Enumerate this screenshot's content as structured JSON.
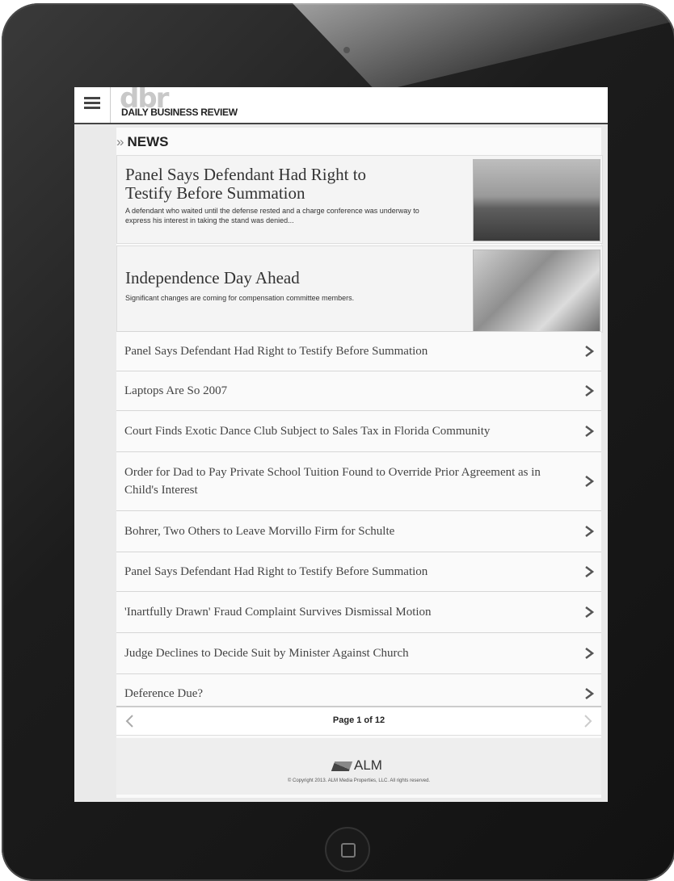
{
  "header": {
    "logo_mark": "dbr",
    "logo_text": "DAILY BUSINESS REVIEW"
  },
  "section": {
    "chevron": "»",
    "title": "NEWS"
  },
  "features": [
    {
      "headline": "Panel Says Defendant Had Right to Testify Before Summation",
      "summary": "A defendant who waited until the defense rested and a charge conference was underway to express his interest in taking the stand was denied..."
    },
    {
      "headline": "Independence Day Ahead",
      "summary": "Significant changes are coming for compensation committee members."
    }
  ],
  "articles": [
    "Panel Says Defendant Had Right to Testify Before Summation",
    "Laptops Are So 2007",
    "Court Finds Exotic Dance Club Subject to Sales Tax in Florida Community",
    "Order for Dad to Pay Private School Tuition Found to Override Prior Agreement as in Child's Interest",
    "Bohrer, Two Others to Leave Morvillo Firm for Schulte",
    "Panel Says Defendant Had Right to Testify Before Summation",
    "'Inartfully Drawn' Fraud Complaint Survives Dismissal Motion",
    "Judge Declines to Decide Suit by Minister Against Church",
    "Deference Due?"
  ],
  "pager": {
    "label": "Page 1 of 12"
  },
  "footer": {
    "brand": "ALM",
    "copyright": "© Copyright 2013. ALM Media Properties, LLC. All rights reserved."
  },
  "icons": {
    "menu": "hamburger-menu-icon",
    "row_arrow": "chevron-right-icon",
    "prev": "chevron-left-icon",
    "next": "chevron-right-icon"
  }
}
